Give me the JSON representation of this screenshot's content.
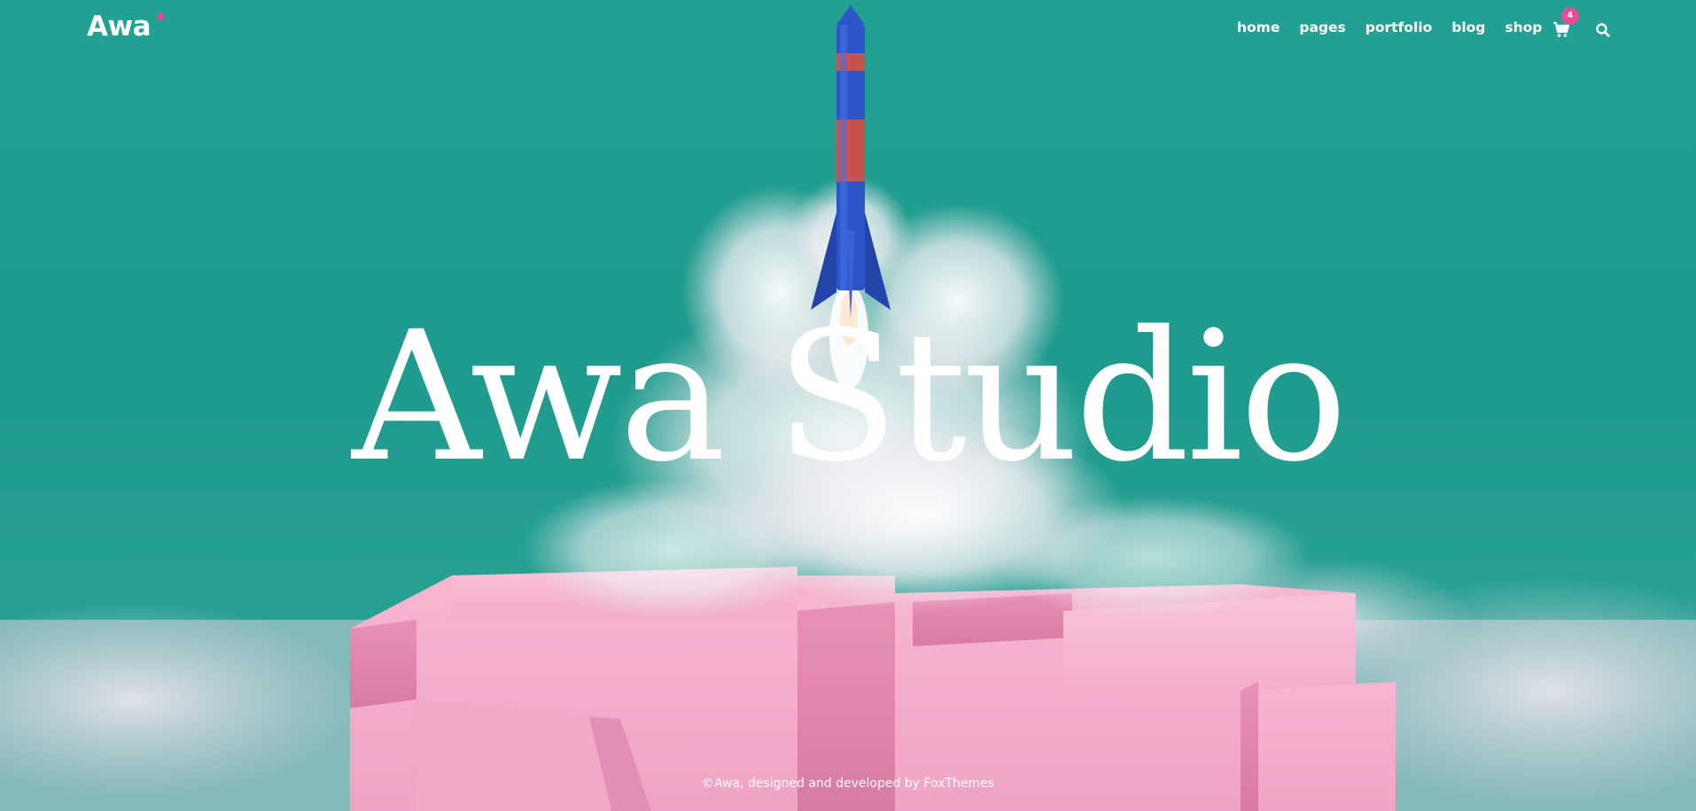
{
  "brand": {
    "logo_text": "Awa",
    "accent_color": "#e9458f"
  },
  "nav": {
    "items": [
      {
        "label": "home"
      },
      {
        "label": "pages"
      },
      {
        "label": "portfolio"
      },
      {
        "label": "blog"
      },
      {
        "label": "shop"
      }
    ],
    "cart_icon": "cart-icon",
    "cart_count": "4",
    "search_icon": "search-icon"
  },
  "hero": {
    "title": "Awa Studio",
    "background_color": "#22a192",
    "pedestal_color": "#f4b3cf",
    "rocket_color": "#2e54c9"
  },
  "footer": {
    "credit": "©Awa, designed and developed by FoxThemes"
  }
}
